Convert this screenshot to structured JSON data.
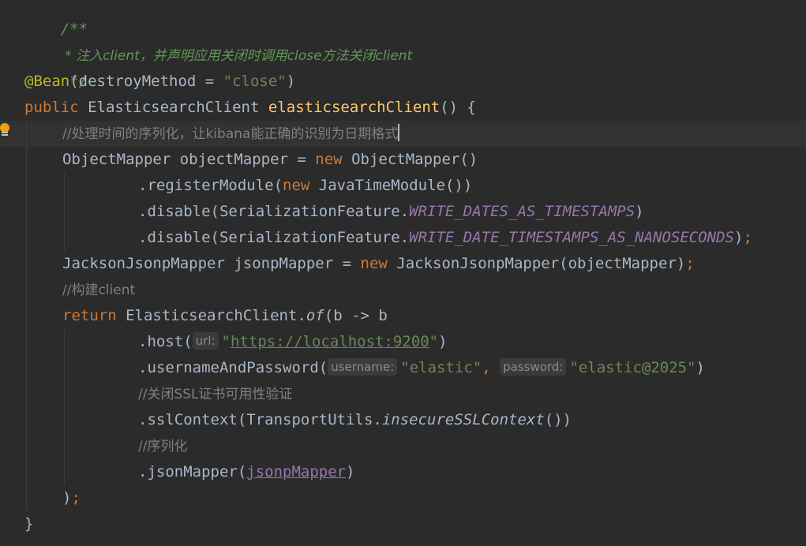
{
  "editor": {
    "lines": {
      "l1": "/**",
      "l2": " * 注入client，并声明应用关闭时调用close方法关闭client",
      "l3": " */",
      "l4_annotation": "@Bean",
      "l4_open": "(destroyMethod = ",
      "l4_str": "\"close\"",
      "l4_close": ")",
      "l5_kw": "public",
      "l5_type": "ElasticsearchClient",
      "l5_method": "elasticsearchClient",
      "l5_rest": "() {",
      "l6_comment": "//处理时间的序列化，让kibana能正确的识别为日期格式",
      "l7_a": "ObjectMapper objectMapper = ",
      "l7_new": "new",
      "l7_b": " ObjectMapper()",
      "l8_a": ".registerModule(",
      "l8_new": "new",
      "l8_b": " JavaTimeModule())",
      "l9_a": ".disable(SerializationFeature.",
      "l9_const": "WRITE_DATES_AS_TIMESTAMPS",
      "l9_b": ")",
      "l10_a": ".disable(SerializationFeature.",
      "l10_const": "WRITE_DATE_TIMESTAMPS_AS_NANOSECONDS",
      "l10_b": ")",
      "l10_semi": ";",
      "l11_a": "JacksonJsonpMapper jsonpMapper = ",
      "l11_new": "new",
      "l11_b": " JacksonJsonpMapper(objectMapper)",
      "l11_semi": ";",
      "l12_comment": "//构建client",
      "l13_kw": "return",
      "l13_a": " ElasticsearchClient.",
      "l13_of": "of",
      "l13_b": "(b -> b",
      "l14_a": ".host(",
      "l14_hint": "url:",
      "l14_q1": "\"",
      "l14_url": "https://localhost:9200",
      "l14_q2": "\"",
      "l14_b": ")",
      "l15_a": ".usernameAndPassword(",
      "l15_hint1": "username:",
      "l15_str1": "\"elastic\"",
      "l15_comma": ", ",
      "l15_hint2": "password:",
      "l15_str2": "\"elastic@2025\"",
      "l15_b": ")",
      "l16_comment": "//关闭SSL证书可用性验证",
      "l17_a": ".sslContext(TransportUtils.",
      "l17_method": "insecureSSLContext",
      "l17_b": "())",
      "l18_comment": "//序列化",
      "l19_a": ".jsonMapper(",
      "l19_var": "jsonpMapper",
      "l19_b": ")",
      "l20_paren": ")",
      "l20_semi": ";",
      "l21": "}"
    },
    "colors": {
      "background": "#2b2b2b",
      "current_line": "#323232",
      "keyword": "#cc7832",
      "method": "#ffc66d",
      "string": "#6a8759",
      "comment": "#808080",
      "doc_comment": "#629755",
      "annotation": "#bbb529",
      "constant": "#9876aa"
    }
  }
}
